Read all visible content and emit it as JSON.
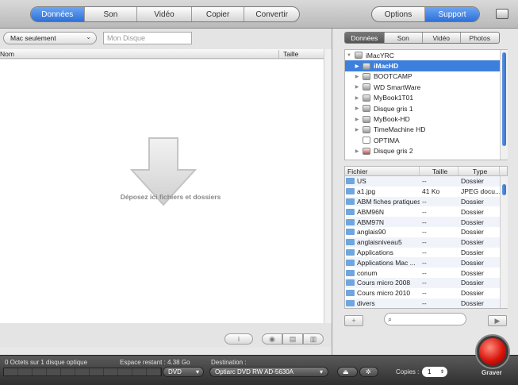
{
  "toolbar": {
    "left_tabs": [
      "Données",
      "Son",
      "Vidéo",
      "Copier",
      "Convertir"
    ],
    "right_tabs": [
      "Options",
      "Support"
    ]
  },
  "left": {
    "format_select": "Mac seulement",
    "disc_name_placeholder": "Mon Disque",
    "col_name": "Nom",
    "col_size": "Taille",
    "drop_text": "Déposez ici fichiers et dossiers"
  },
  "right": {
    "tabs": [
      "Données",
      "Son",
      "Vidéo",
      "Photos"
    ],
    "tree": [
      {
        "label": "iMacYRC",
        "level": 0
      },
      {
        "label": "iMacHD",
        "level": 1
      },
      {
        "label": "BOOTCAMP",
        "level": 1
      },
      {
        "label": "WD SmartWare",
        "level": 1
      },
      {
        "label": "MyBook1T01",
        "level": 1
      },
      {
        "label": "Disque gris 1",
        "level": 1
      },
      {
        "label": "MyBook-HD",
        "level": 1
      },
      {
        "label": "TimeMachine HD",
        "level": 1
      },
      {
        "label": "OPTIMA",
        "level": 1
      },
      {
        "label": "Disque gris 2",
        "level": 1
      }
    ],
    "file_headers": {
      "name": "Fichier",
      "size": "Taille",
      "type": "Type"
    },
    "files": [
      {
        "name": "US",
        "size": "--",
        "type": "Dossier"
      },
      {
        "name": "a1.jpg",
        "size": "41 Ko",
        "type": "JPEG docu..."
      },
      {
        "name": "ABM fiches pratiques",
        "size": "--",
        "type": "Dossier"
      },
      {
        "name": "ABM96N",
        "size": "--",
        "type": "Dossier"
      },
      {
        "name": "ABM97N",
        "size": "--",
        "type": "Dossier"
      },
      {
        "name": "anglais90",
        "size": "--",
        "type": "Dossier"
      },
      {
        "name": "anglaisniveau5",
        "size": "--",
        "type": "Dossier"
      },
      {
        "name": "Applications",
        "size": "--",
        "type": "Dossier"
      },
      {
        "name": "Applications Mac ...",
        "size": "--",
        "type": "Dossier"
      },
      {
        "name": "conum",
        "size": "--",
        "type": "Dossier"
      },
      {
        "name": "Cours micro 2008",
        "size": "--",
        "type": "Dossier"
      },
      {
        "name": "Cours micro 2010",
        "size": "--",
        "type": "Dossier"
      },
      {
        "name": "divers",
        "size": "--",
        "type": "Dossier"
      }
    ],
    "search_placeholder": ""
  },
  "bottom": {
    "status": "0 Octets sur 1 disque optique",
    "space_label": "Espace restant : 4.38 Go",
    "disc_type": "DVD",
    "destination_label": "Destination :",
    "destination": "Optiarc DVD RW AD-5630A",
    "copies_label": "Copies :",
    "copies_value": "1",
    "burn_label": "Graver"
  },
  "colors": {
    "accent": "#3d7fdc",
    "burn": "#d8140c"
  }
}
